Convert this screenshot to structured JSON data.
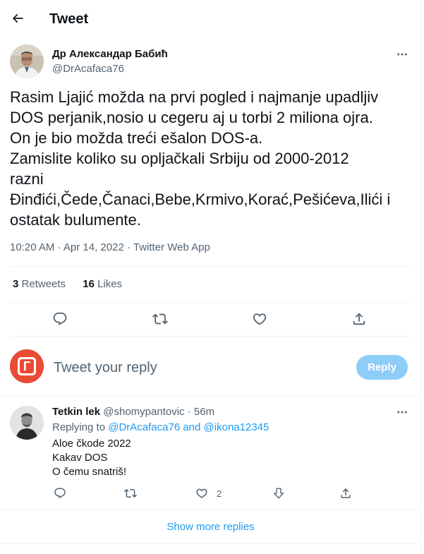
{
  "header": {
    "title": "Tweet"
  },
  "tweet": {
    "author_name": "Др Александар Бабић",
    "author_handle": "@DrAcafaca76",
    "text_lines": [
      "Rasim Ljajić možda na prvi pogled i najmanje upadljiv",
      "DOS perjanik,nosio u cegeru aj u torbi 2 miliona ojra.",
      "On je bio možda treći ešalon DOS-a.",
      "Zamislite koliko su opljačkali Srbiju od 2000-2012",
      "razni",
      "Đinđići,Čede,Čanaci,Bebe,Krmivo,Korać,Pešićeva,Ilići i",
      "ostatak bulumente."
    ],
    "time": "10:20 AM",
    "separator": "·",
    "date": "Apr 14, 2022",
    "source": "Twitter Web App",
    "retweets_count": "3",
    "retweets_label": "Retweets",
    "likes_count": "16",
    "likes_label": "Likes"
  },
  "compose": {
    "placeholder": "Tweet your reply",
    "button_label": "Reply",
    "avatar_letter": "Г"
  },
  "reply": {
    "name": "Tetkin lek",
    "handle": "@shomypantovic",
    "dot": "·",
    "time": "56m",
    "replying_prefix": "Replying to",
    "mention1": "@DrAcafaca76",
    "and_word": "and",
    "mention2": "@ikona12345",
    "text_lines": [
      "Aloe čkode 2022",
      "Kakav DOS",
      "O čemu snatriš!"
    ],
    "like_count": "2"
  },
  "show_more": "Show more replies",
  "colors": {
    "accent": "#1d9bf0",
    "reply_button_disabled": "#8ecdf8",
    "muted": "#536471",
    "text": "#0f1419",
    "border": "#eff3f4",
    "avatar_brand": "#e94b35"
  },
  "icons": [
    "back-arrow-icon",
    "more-icon",
    "reply-icon",
    "retweet-icon",
    "like-icon",
    "share-icon"
  ]
}
